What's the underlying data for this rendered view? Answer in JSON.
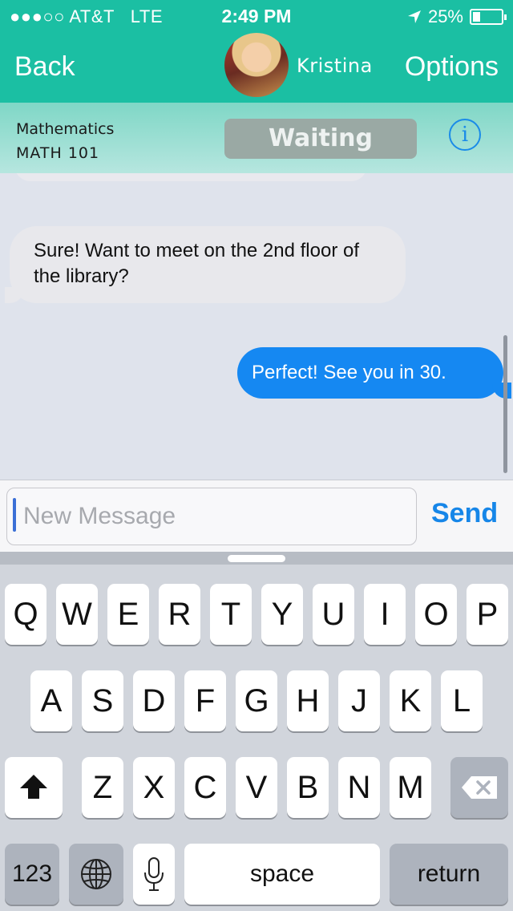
{
  "status_bar": {
    "signal": "●●●○○",
    "carrier": "AT&T",
    "network": "LTE",
    "time": "2:49 PM",
    "location_icon": "location-arrow-icon",
    "battery": "25%",
    "battery_level": 0.25
  },
  "nav": {
    "back_label": "Back",
    "contact_name": "Kristina",
    "options_label": "Options"
  },
  "course": {
    "title": "Mathematics",
    "code": "MATH 101",
    "status_label": "Waiting",
    "info_icon": "i"
  },
  "messages": [
    {
      "direction": "incoming",
      "text": "Sure! Want to meet on the 2nd floor of the library?"
    },
    {
      "direction": "outgoing",
      "text": "Perfect! See you in 30."
    }
  ],
  "compose": {
    "placeholder": "New Message",
    "send_label": "Send"
  },
  "keyboard": {
    "row1": [
      "Q",
      "W",
      "E",
      "R",
      "T",
      "Y",
      "U",
      "I",
      "O",
      "P"
    ],
    "row2": [
      "A",
      "S",
      "D",
      "F",
      "G",
      "H",
      "J",
      "K",
      "L"
    ],
    "row3": [
      "Z",
      "X",
      "C",
      "V",
      "B",
      "N",
      "M"
    ],
    "numbers_label": "123",
    "space_label": "space",
    "return_label": "return",
    "shift_icon": "shift-arrow-icon",
    "delete_icon": "delete-backspace-icon",
    "globe_icon": "globe-icon",
    "mic_icon": "microphone-icon"
  },
  "colors": {
    "header": "#1bbfa3",
    "outgoing_bubble": "#1588f2",
    "incoming_bubble": "#e8e8ec",
    "send": "#1686e8"
  }
}
